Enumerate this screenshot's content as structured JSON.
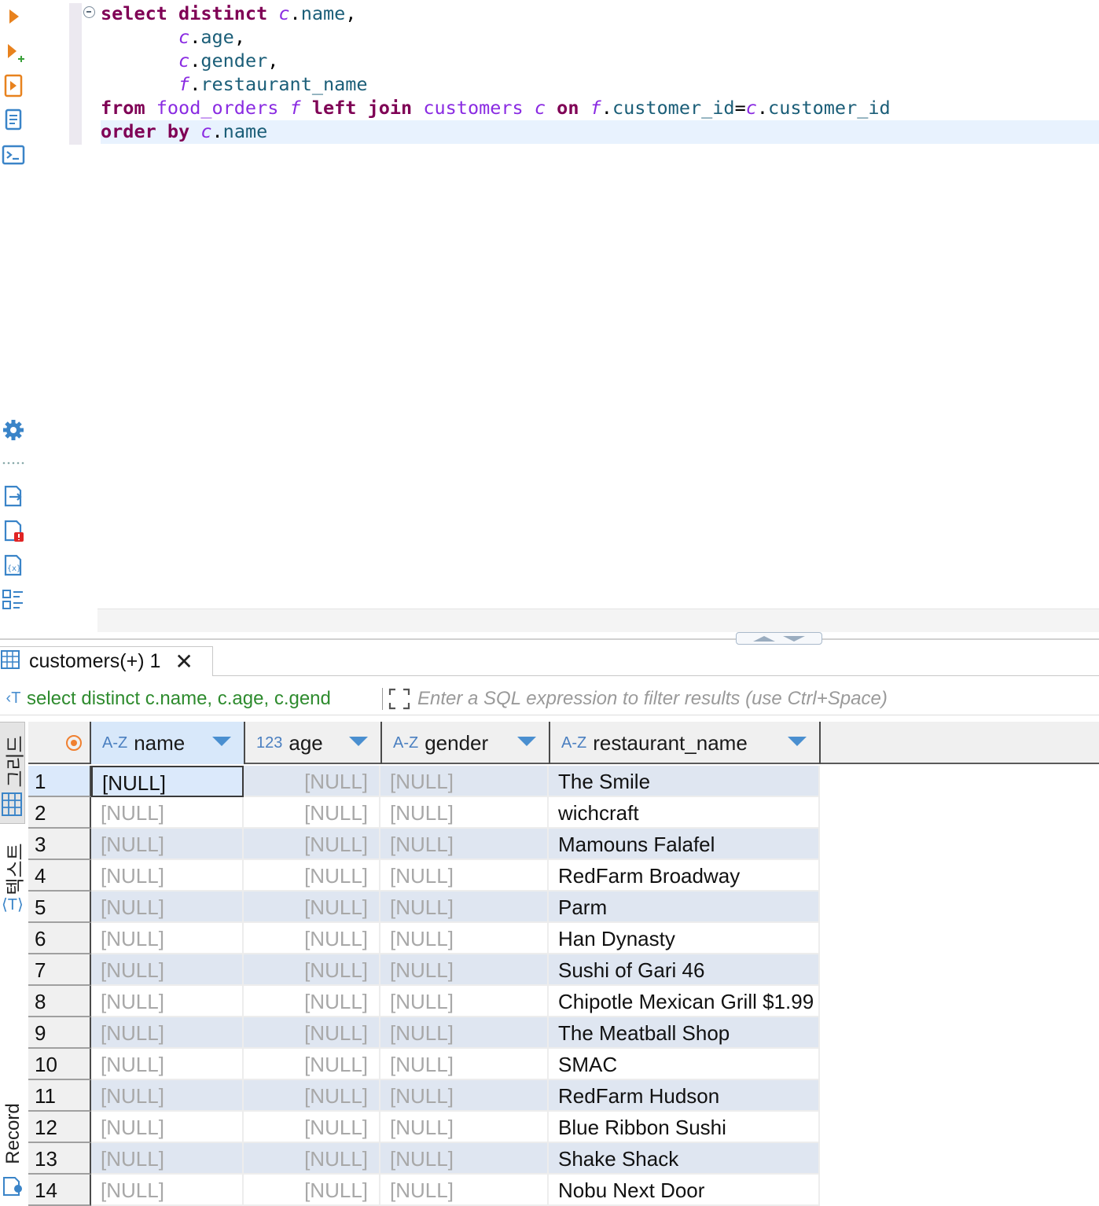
{
  "editor": {
    "lines": [
      [
        [
          "kw",
          "select"
        ],
        [
          "p",
          " "
        ],
        [
          "kw",
          "distinct"
        ],
        [
          "p",
          " "
        ],
        [
          "al",
          "c"
        ],
        [
          "p",
          "."
        ],
        [
          "col",
          "name"
        ],
        [
          "p",
          ","
        ]
      ],
      [
        [
          "p",
          "       "
        ],
        [
          "al",
          "c"
        ],
        [
          "p",
          "."
        ],
        [
          "col",
          "age"
        ],
        [
          "p",
          ","
        ]
      ],
      [
        [
          "p",
          "       "
        ],
        [
          "al",
          "c"
        ],
        [
          "p",
          "."
        ],
        [
          "col",
          "gender"
        ],
        [
          "p",
          ","
        ]
      ],
      [
        [
          "p",
          "       "
        ],
        [
          "al",
          "f"
        ],
        [
          "p",
          "."
        ],
        [
          "col",
          "restaurant_name"
        ]
      ],
      [
        [
          "kw",
          "from"
        ],
        [
          "p",
          " "
        ],
        [
          "tb",
          "food_orders"
        ],
        [
          "p",
          " "
        ],
        [
          "al",
          "f"
        ],
        [
          "p",
          " "
        ],
        [
          "kw",
          "left"
        ],
        [
          "p",
          " "
        ],
        [
          "kw",
          "join"
        ],
        [
          "p",
          " "
        ],
        [
          "tb",
          "customers"
        ],
        [
          "p",
          " "
        ],
        [
          "al",
          "c"
        ],
        [
          "p",
          " "
        ],
        [
          "kw",
          "on"
        ],
        [
          "p",
          " "
        ],
        [
          "al",
          "f"
        ],
        [
          "p",
          "."
        ],
        [
          "col",
          "customer_id"
        ],
        [
          "p",
          "="
        ],
        [
          "al",
          "c"
        ],
        [
          "p",
          "."
        ],
        [
          "col",
          "customer_id"
        ]
      ],
      [
        [
          "kw",
          "order"
        ],
        [
          "p",
          " "
        ],
        [
          "kw",
          "by"
        ],
        [
          "p",
          " "
        ],
        [
          "al",
          "c"
        ],
        [
          "p",
          "."
        ],
        [
          "col",
          "name"
        ]
      ]
    ]
  },
  "result_tab": {
    "label": "customers(+) 1",
    "close_glyph": "✕"
  },
  "filter_bar": {
    "query_text": "select distinct c.name, c.age, c.gend",
    "placeholder": "Enter a SQL expression to filter results (use Ctrl+Space)"
  },
  "side_tabs": {
    "grid": "그리드",
    "text": "텍스트",
    "record": "Record"
  },
  "grid": {
    "columns": [
      {
        "type": "A-Z",
        "name": "name"
      },
      {
        "type": "123",
        "name": "age"
      },
      {
        "type": "A-Z",
        "name": "gender"
      },
      {
        "type": "A-Z",
        "name": "restaurant_name"
      }
    ],
    "rows": [
      {
        "num": "1",
        "name": "[NULL]",
        "age": "[NULL]",
        "gender": "[NULL]",
        "restaurant": "The Smile"
      },
      {
        "num": "2",
        "name": "[NULL]",
        "age": "[NULL]",
        "gender": "[NULL]",
        "restaurant": "wichcraft"
      },
      {
        "num": "3",
        "name": "[NULL]",
        "age": "[NULL]",
        "gender": "[NULL]",
        "restaurant": "Mamouns Falafel"
      },
      {
        "num": "4",
        "name": "[NULL]",
        "age": "[NULL]",
        "gender": "[NULL]",
        "restaurant": "RedFarm Broadway"
      },
      {
        "num": "5",
        "name": "[NULL]",
        "age": "[NULL]",
        "gender": "[NULL]",
        "restaurant": "Parm"
      },
      {
        "num": "6",
        "name": "[NULL]",
        "age": "[NULL]",
        "gender": "[NULL]",
        "restaurant": "Han Dynasty"
      },
      {
        "num": "7",
        "name": "[NULL]",
        "age": "[NULL]",
        "gender": "[NULL]",
        "restaurant": "Sushi of Gari 46"
      },
      {
        "num": "8",
        "name": "[NULL]",
        "age": "[NULL]",
        "gender": "[NULL]",
        "restaurant": "Chipotle Mexican Grill $1.99"
      },
      {
        "num": "9",
        "name": "[NULL]",
        "age": "[NULL]",
        "gender": "[NULL]",
        "restaurant": "The Meatball Shop"
      },
      {
        "num": "10",
        "name": "[NULL]",
        "age": "[NULL]",
        "gender": "[NULL]",
        "restaurant": "SMAC"
      },
      {
        "num": "11",
        "name": "[NULL]",
        "age": "[NULL]",
        "gender": "[NULL]",
        "restaurant": "RedFarm Hudson"
      },
      {
        "num": "12",
        "name": "[NULL]",
        "age": "[NULL]",
        "gender": "[NULL]",
        "restaurant": "Blue Ribbon Sushi"
      },
      {
        "num": "13",
        "name": "[NULL]",
        "age": "[NULL]",
        "gender": "[NULL]",
        "restaurant": "Shake Shack"
      },
      {
        "num": "14",
        "name": "[NULL]",
        "age": "[NULL]",
        "gender": "[NULL]",
        "restaurant": "Nobu Next Door"
      }
    ]
  },
  "colors": {
    "keyword": "#7f0055",
    "alias": "#8a2be2",
    "column": "#1b5e78",
    "query_text": "#2e8b2e",
    "accent": "#4a8fd0",
    "orange_icon": "#e8821e"
  }
}
